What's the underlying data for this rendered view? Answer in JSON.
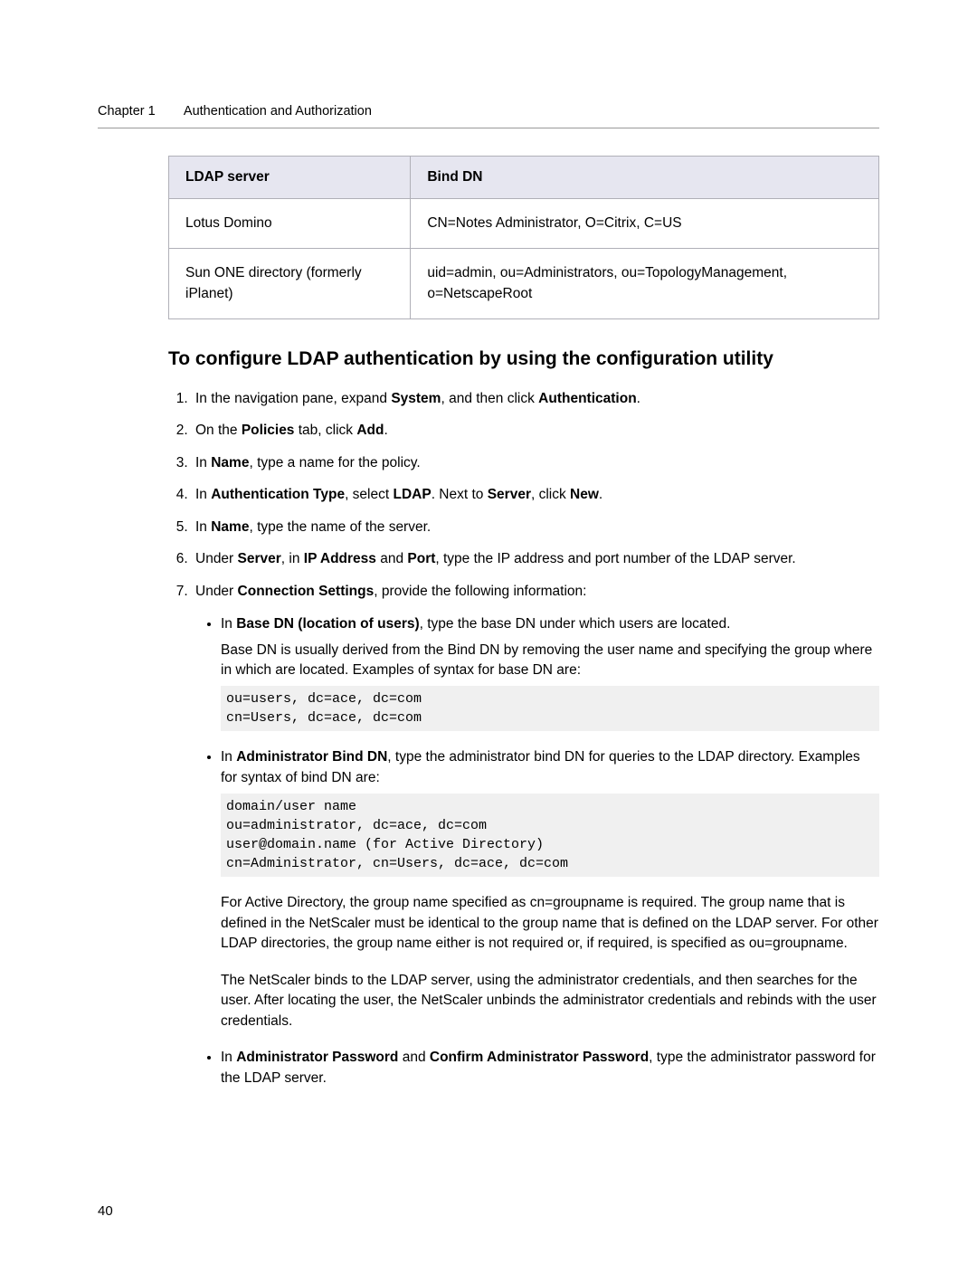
{
  "header": {
    "chapter": "Chapter 1",
    "title": "Authentication and Authorization"
  },
  "table": {
    "head": {
      "c1": "LDAP server",
      "c2": "Bind DN"
    },
    "rows": [
      {
        "c1": "Lotus Domino",
        "c2": "CN=Notes Administrator, O=Citrix, C=US"
      },
      {
        "c1": "Sun ONE directory (formerly iPlanet)",
        "c2": "uid=admin, ou=Administrators, ou=TopologyManagement, o=NetscapeRoot"
      }
    ]
  },
  "section_heading": "To configure LDAP authentication by using the configuration utility",
  "steps": {
    "s1": {
      "pre": "In the navigation pane, expand ",
      "b1": "System",
      "mid": ", and then click ",
      "b2": "Authentication",
      "post": "."
    },
    "s2": {
      "pre": "On the ",
      "b1": "Policies",
      "mid": " tab, click ",
      "b2": "Add",
      "post": "."
    },
    "s3": {
      "pre": "In ",
      "b1": "Name",
      "post": ", type a name for the policy."
    },
    "s4": {
      "pre": "In ",
      "b1": "Authentication Type",
      "mid1": ", select ",
      "b2": "LDAP",
      "mid2": ". Next to ",
      "b3": "Server",
      "mid3": ", click ",
      "b4": "New",
      "post": "."
    },
    "s5": {
      "pre": "In ",
      "b1": "Name",
      "post": ", type the name of the server."
    },
    "s6": {
      "pre": "Under ",
      "b1": "Server",
      "mid1": ", in ",
      "b2": "IP Address",
      "mid2": " and ",
      "b3": "Port",
      "post": ", type the IP address and port number of the LDAP server."
    },
    "s7": {
      "pre": "Under ",
      "b1": "Connection Settings",
      "post": ", provide the following information:"
    }
  },
  "sub": {
    "a": {
      "pre": "In ",
      "b1": "Base DN (location of users)",
      "post": ", type the base DN under which users are located.",
      "para": "Base DN is usually derived from the Bind DN by removing the user name and specifying the group where in which are located. Examples of syntax for base DN are:",
      "code": "ou=users, dc=ace, dc=com\ncn=Users, dc=ace, dc=com"
    },
    "b": {
      "pre": "In ",
      "b1": "Administrator Bind DN",
      "post": ", type the administrator bind DN for queries to the LDAP directory. Examples for syntax of bind DN are:",
      "code": "domain/user name\nou=administrator, dc=ace, dc=com\nuser@domain.name (for Active Directory)\ncn=Administrator, cn=Users, dc=ace, dc=com",
      "para1": "For Active Directory, the group name specified as cn=groupname is required. The group name that is defined in the NetScaler must be identical to the group name that is defined on the LDAP server. For other LDAP directories, the group name either is not required or, if required, is specified as ou=groupname.",
      "para2": "The NetScaler binds to the LDAP server, using the administrator credentials, and then searches for the user. After locating the user, the NetScaler unbinds the administrator credentials and rebinds with the user credentials."
    },
    "c": {
      "pre": "In ",
      "b1": "Administrator Password",
      "mid": " and ",
      "b2": "Confirm Administrator Password",
      "post": ", type the administrator password for the LDAP server."
    }
  },
  "page_number": "40"
}
